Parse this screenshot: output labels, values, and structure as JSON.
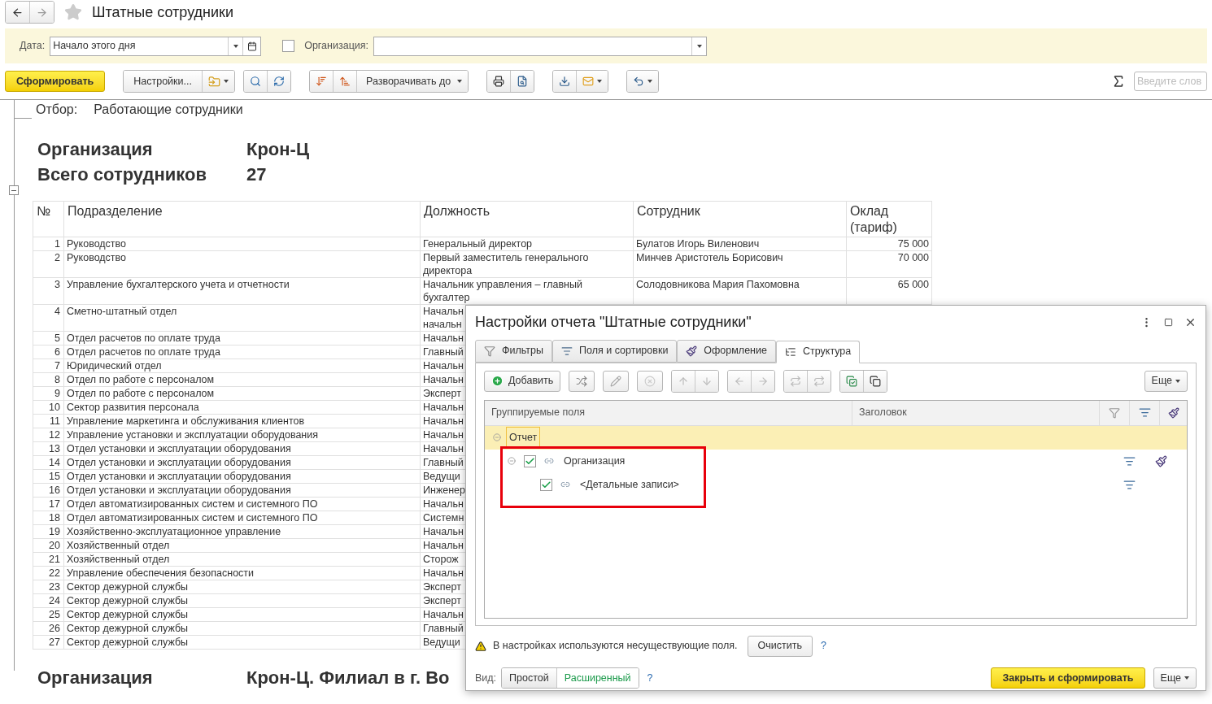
{
  "window": {
    "title": "Штатные сотрудники",
    "favorite": false
  },
  "params": {
    "date_label": "Дата:",
    "date_value": "Начало этого дня",
    "org_checked": false,
    "org_label": "Организация:"
  },
  "toolbar": {
    "generate": "Сформировать",
    "settings": "Настройки...",
    "expand": "Разворачивать до",
    "search_placeholder": "Введите слов"
  },
  "report": {
    "filter_label": "Отбор:",
    "filter_value": "Работающие сотрудники",
    "header": [
      {
        "label": "Организация",
        "value": "Крон-Ц"
      },
      {
        "label": "Всего сотрудников",
        "value": "27"
      }
    ],
    "table": {
      "columns": [
        "№",
        "Подразделение",
        "Должность",
        "Сотрудник",
        "Оклад (тариф)"
      ],
      "rows": [
        {
          "n": "1",
          "dept": "Руководство",
          "position": [
            "Генеральный директор"
          ],
          "employee": "Булатов Игорь Виленович",
          "salary": "75 000"
        },
        {
          "n": "2",
          "dept": "Руководство",
          "position": [
            "Первый заместитель генерального",
            "директора"
          ],
          "employee": "Минчев Аристотель Борисович",
          "salary": "70 000"
        },
        {
          "n": "3",
          "dept": "Управление бухгалтерского учета и отчетности",
          "position": [
            "Начальник управления – главный",
            "бухгалтер"
          ],
          "employee": "Солодовникова Мария Пахомовна",
          "salary": "65 000"
        },
        {
          "n": "4",
          "dept": "Сметно-штатный отдел",
          "position": [
            "Начальн",
            "начальн"
          ]
        },
        {
          "n": "5",
          "dept": "Отдел расчетов по оплате труда",
          "position": [
            "Начальн"
          ]
        },
        {
          "n": "6",
          "dept": "Отдел расчетов по оплате труда",
          "position": [
            "Главный"
          ]
        },
        {
          "n": "7",
          "dept": "Юридический отдел",
          "position": [
            "Начальн"
          ]
        },
        {
          "n": "8",
          "dept": "Отдел по работе с персоналом",
          "position": [
            "Начальн"
          ]
        },
        {
          "n": "9",
          "dept": "Отдел по работе с персоналом",
          "position": [
            "Эксперт"
          ]
        },
        {
          "n": "10",
          "dept": "Сектор развития персонала",
          "position": [
            "Начальн"
          ]
        },
        {
          "n": "11",
          "dept": "Управление маркетинга и обслуживания клиентов",
          "position": [
            "Начальн"
          ]
        },
        {
          "n": "12",
          "dept": "Управление установки и эксплуатации оборудования",
          "position": [
            "Начальн"
          ]
        },
        {
          "n": "13",
          "dept": "Отдел установки и эксплуатации оборудования",
          "position": [
            "Начальн"
          ]
        },
        {
          "n": "14",
          "dept": "Отдел установки и эксплуатации оборудования",
          "position": [
            "Главный"
          ]
        },
        {
          "n": "15",
          "dept": "Отдел установки и эксплуатации оборудования",
          "position": [
            "Ведущи"
          ]
        },
        {
          "n": "16",
          "dept": "Отдел установки и эксплуатации оборудования",
          "position": [
            "Инженер"
          ]
        },
        {
          "n": "17",
          "dept": "Отдел автоматизированных систем и системного ПО",
          "position": [
            "Начальн"
          ]
        },
        {
          "n": "18",
          "dept": "Отдел автоматизированных систем и системного ПО",
          "position": [
            "Системн"
          ]
        },
        {
          "n": "19",
          "dept": "Хозяйственно-эксплуатационное управление",
          "position": [
            "Начальн"
          ]
        },
        {
          "n": "20",
          "dept": "Хозяйственный отдел",
          "position": [
            "Начальн"
          ]
        },
        {
          "n": "21",
          "dept": "Хозяйственный отдел",
          "position": [
            "Сторож"
          ]
        },
        {
          "n": "22",
          "dept": "Управление обеспечения безопасности",
          "position": [
            "Начальн"
          ]
        },
        {
          "n": "23",
          "dept": "Сектор дежурной службы",
          "position": [
            "Эксперт"
          ]
        },
        {
          "n": "24",
          "dept": "Сектор дежурной службы",
          "position": [
            "Эксперт"
          ]
        },
        {
          "n": "25",
          "dept": "Сектор дежурной службы",
          "position": [
            "Начальн"
          ]
        },
        {
          "n": "26",
          "dept": "Сектор дежурной службы",
          "position": [
            "Главный"
          ]
        },
        {
          "n": "27",
          "dept": "Сектор дежурной службы",
          "position": [
            "Ведущи"
          ]
        }
      ]
    },
    "next_group": {
      "label": "Организация",
      "value": "Крон-Ц. Филиал в г. Во"
    }
  },
  "dialog": {
    "title": "Настройки отчета \"Штатные сотрудники\"",
    "tabs": [
      {
        "label": "Фильтры",
        "kind": "filter",
        "selected": false
      },
      {
        "label": "Поля и сортировки",
        "kind": "fields",
        "selected": false
      },
      {
        "label": "Оформление",
        "kind": "design",
        "selected": false
      },
      {
        "label": "Структура",
        "kind": "structure",
        "selected": true
      }
    ],
    "add": "Добавить",
    "more": "Еще",
    "columns": [
      "Группируемые поля",
      "Заголовок"
    ],
    "tree": {
      "label": "Отчет",
      "expanded": true,
      "selected": true,
      "children": [
        {
          "label": "Организация",
          "checked": true,
          "expanded": true,
          "design": true,
          "children": [
            {
              "label": "<Детальные записи>",
              "checked": true,
              "design": false
            }
          ]
        }
      ]
    },
    "warning": "В настройках используются несуществующие поля.",
    "clear": "Очистить",
    "help": "?",
    "view_label": "Вид:",
    "modes": [
      {
        "label": "Простой",
        "selected": false
      },
      {
        "label": "Расширенный",
        "selected": true
      }
    ],
    "view_help": "?",
    "submit": "Закрыть и сформировать",
    "more_bottom": "Еще"
  }
}
